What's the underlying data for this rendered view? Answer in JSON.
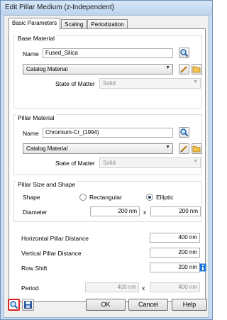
{
  "window": {
    "title": "Edit Pillar Medium (z-Independent)"
  },
  "tabs": [
    {
      "label": "Basic Parameters"
    },
    {
      "label": "Scaling"
    },
    {
      "label": "Periodization"
    }
  ],
  "base_material": {
    "group_title": "Base Material",
    "name_label": "Name",
    "name_value": "Fused_Silica",
    "catalog_value": "Catalog Material",
    "state_label": "State of Matter",
    "state_value": "Solid"
  },
  "pillar_material": {
    "group_title": "Pillar Material",
    "name_label": "Name",
    "name_value": "Chromium-Cr_(1994)",
    "catalog_value": "Catalog Material",
    "state_label": "State of Matter",
    "state_value": "Solid"
  },
  "pillar_shape": {
    "group_title": "Pillar Size and Shape",
    "shape_label": "Shape",
    "option_rect": "Rectangular",
    "option_elliptic": "Elliptic",
    "selected": "Elliptic",
    "diameter_label": "Diameter",
    "diameter_x": "200 nm",
    "x_label": "x",
    "diameter_y": "200 nm"
  },
  "distances": {
    "horizontal_label": "Horizontal Pillar Distance",
    "horizontal_value": "400 nm",
    "vertical_label": "Vertical Pillar Distance",
    "vertical_value": "200 nm",
    "row_shift_label": "Row Shift",
    "row_shift_value": "200 nm",
    "period_label": "Period",
    "period_x": "400 nm",
    "x_label": "x",
    "period_y": "400 nm"
  },
  "buttons": {
    "ok": "OK",
    "cancel": "Cancel",
    "help": "Help"
  },
  "colors": {
    "window_frame": "#c9dcf2",
    "title_bar": "#bcd3ee",
    "highlight_red": "#e02020",
    "info_blue": "#1a73d9"
  }
}
